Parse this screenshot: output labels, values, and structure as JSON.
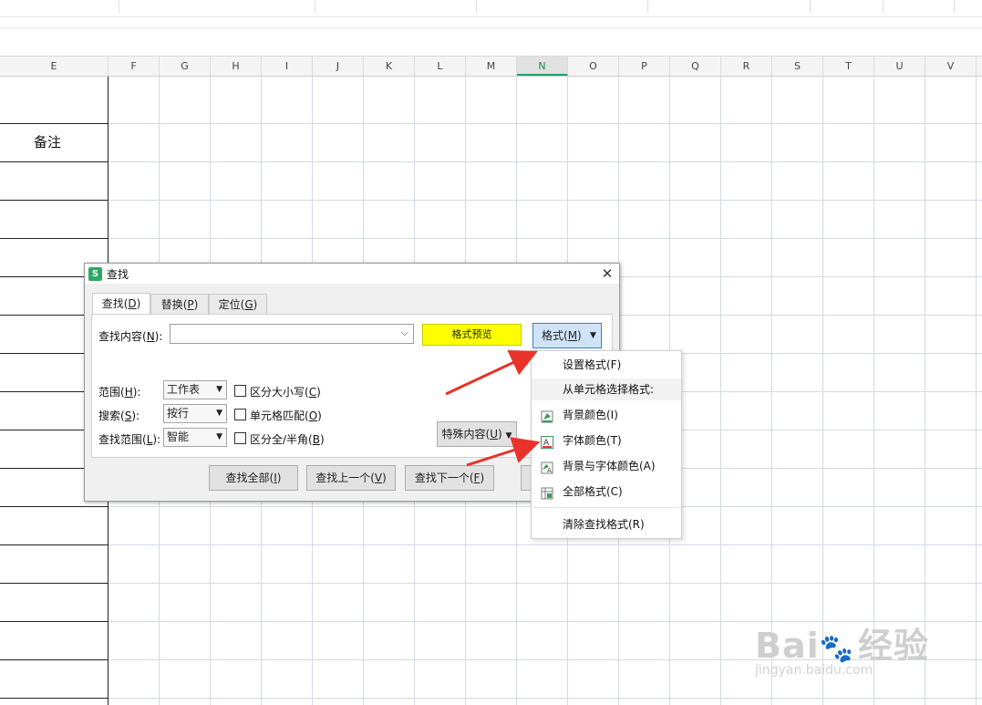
{
  "spreadsheet": {
    "columns": [
      "E",
      "F",
      "G",
      "H",
      "I",
      "J",
      "K",
      "L",
      "M",
      "N",
      "O",
      "P",
      "Q",
      "R",
      "S",
      "T",
      "U",
      "V"
    ],
    "active_column": "N",
    "note_cell": "备注"
  },
  "dialog": {
    "title": "查找",
    "close": "✕",
    "tabs": [
      {
        "label": "查找(",
        "key": "D",
        "suffix": ")"
      },
      {
        "label": "替换(",
        "key": "P",
        "suffix": ")"
      },
      {
        "label": "定位(",
        "key": "G",
        "suffix": ")"
      }
    ],
    "find_label": {
      "label": "查找内容(",
      "key": "N",
      "suffix": "):"
    },
    "find_value": "",
    "format_preview": "格式预览",
    "format_button": {
      "label": "格式(",
      "key": "M",
      "suffix": ")"
    },
    "scope_label": {
      "label": "范围(",
      "key": "H",
      "suffix": "):"
    },
    "scope_value": "工作表",
    "search_label": {
      "label": "搜索(",
      "key": "S",
      "suffix": "):"
    },
    "search_value": "按行",
    "range_label": {
      "label": "查找范围(",
      "key": "L",
      "suffix": "):"
    },
    "range_value": "智能",
    "options": [
      {
        "label": "区分大小写(",
        "key": "C",
        "suffix": ")"
      },
      {
        "label": "单元格匹配(",
        "key": "O",
        "suffix": ")"
      },
      {
        "label": "区分全/半角(",
        "key": "B",
        "suffix": ")"
      }
    ],
    "special_button": {
      "label": "特殊内容(",
      "key": "U",
      "suffix": ")"
    },
    "buttons": [
      {
        "label": "查找全部(",
        "key": "I",
        "suffix": ")"
      },
      {
        "label": "查找上一个(",
        "key": "V",
        "suffix": ")"
      },
      {
        "label": "查找下一个(",
        "key": "F",
        "suffix": ")"
      }
    ]
  },
  "format_menu": {
    "set_format": "设置格式(F)",
    "from_cell_header": "从单元格选择格式:",
    "items": [
      {
        "label": "背景颜色(I)",
        "icon": "background-color-icon"
      },
      {
        "label": "字体颜色(T)",
        "icon": "font-color-icon"
      },
      {
        "label": "背景与字体颜色(A)",
        "icon": "background-font-color-icon"
      },
      {
        "label": "全部格式(C)",
        "icon": "all-format-icon"
      }
    ],
    "clear_format": "清除查找格式(R)"
  },
  "watermark": {
    "brand": "Bai",
    "suffix": "经验",
    "url": "jingyan.baidu.com"
  },
  "colors": {
    "preview_bg": "#ffff00",
    "arrow": "#e8322a",
    "active_col": "#21a366"
  }
}
